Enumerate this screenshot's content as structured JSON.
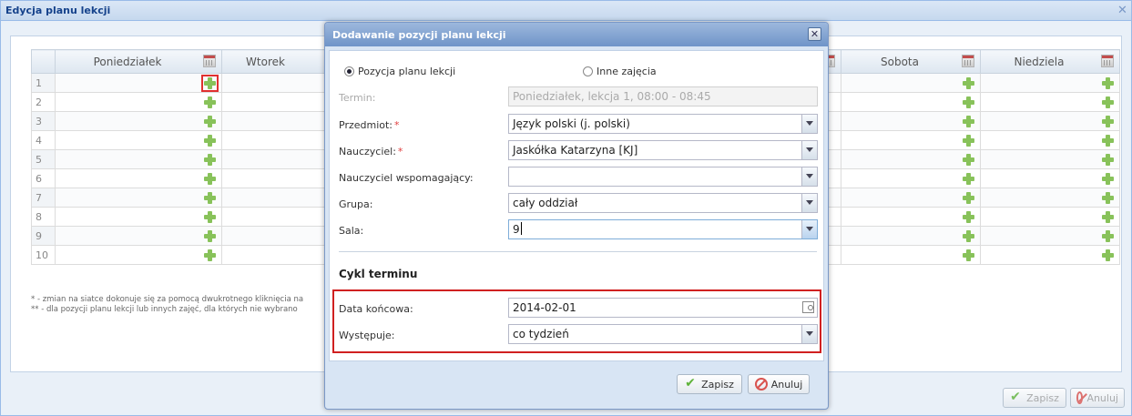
{
  "window": {
    "title": "Edycja planu lekcji",
    "close_glyph": "✕"
  },
  "grid": {
    "days": [
      "Poniedziałek",
      "Wtorek",
      "",
      "",
      "",
      "Sobota",
      "Niedziela"
    ],
    "rows": [
      "1",
      "2",
      "3",
      "4",
      "5",
      "6",
      "7",
      "8",
      "9",
      "10"
    ]
  },
  "notes": [
    "* - zmian na siatce dokonuje się za pomocą dwukrotnego kliknięcia na",
    "** - dla pozycji planu lekcji lub innych zajęć, dla których nie wybrano"
  ],
  "footer": {
    "save_label": "Zapisz",
    "cancel_label": "Anuluj"
  },
  "dialog": {
    "title": "Dodawanie pozycji planu lekcji",
    "close_glyph": "✕",
    "radio_lesson": "Pozycja planu lekcji",
    "radio_other": "Inne zajęcia",
    "term_label": "Termin:",
    "term_value": "Poniedziałek, lekcja 1, 08:00 - 08:45",
    "subject_label": "Przedmiot:",
    "subject_value": "Język polski (j. polski)",
    "teacher_label": "Nauczyciel:",
    "teacher_value": "Jaskółka Katarzyna [KJ]",
    "assistant_label": "Nauczyciel wspomagający:",
    "assistant_value": "",
    "group_label": "Grupa:",
    "group_value": "cały oddział",
    "room_label": "Sala:",
    "room_value": "9",
    "required_mark": "*",
    "cycle_title": "Cykl terminu",
    "end_date_label": "Data końcowa:",
    "end_date_value": "2014-02-01",
    "occurs_label": "Występuje:",
    "occurs_value": "co tydzień",
    "save_label": "Zapisz",
    "cancel_label": "Anuluj"
  },
  "colors": {
    "accent": "#6f94c8",
    "highlight": "#d02020",
    "add_icon": "#88c25a"
  }
}
